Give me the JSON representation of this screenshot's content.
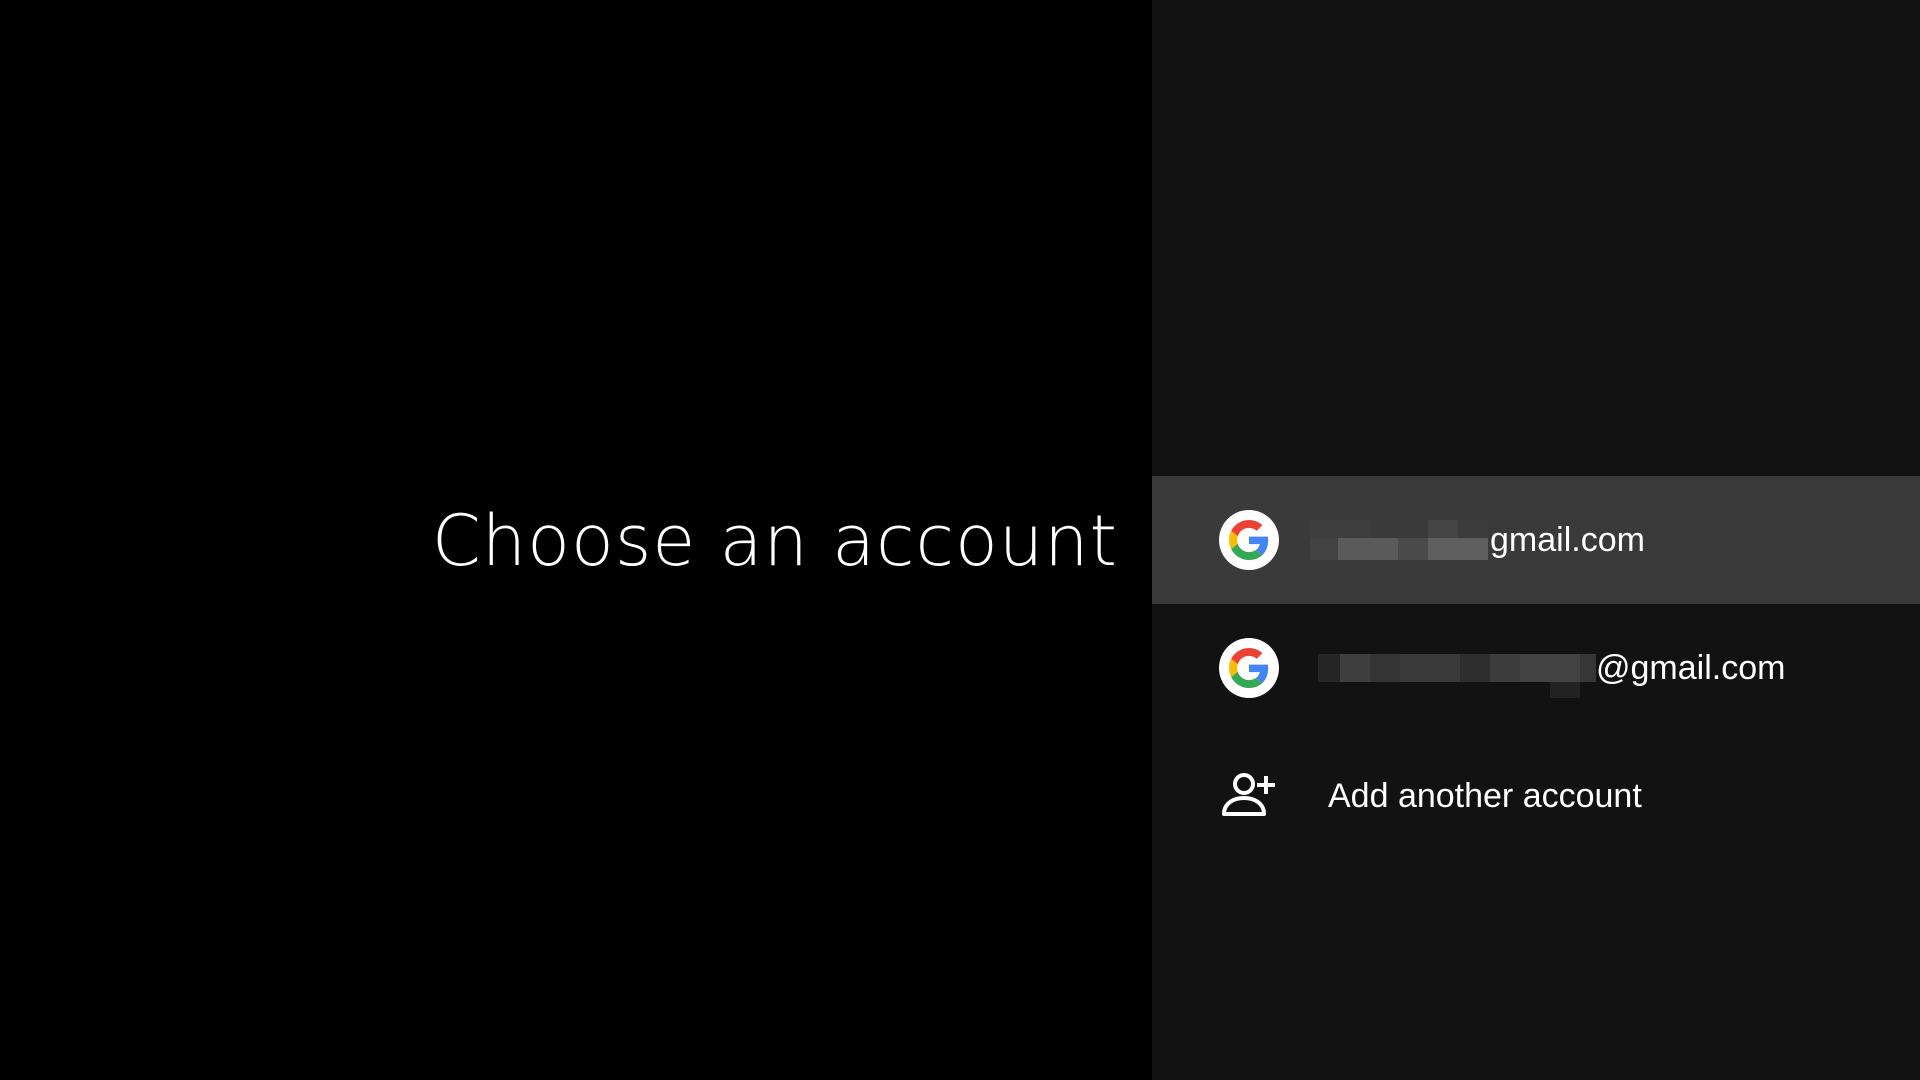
{
  "title": "Choose an account",
  "accounts": [
    {
      "email_visible": "gmail.com",
      "focused": true
    },
    {
      "email_visible": "@gmail.com",
      "focused": false
    }
  ],
  "add_account": {
    "label": "Add another account"
  },
  "colors": {
    "left_background": "#000000",
    "right_background": "#121212",
    "focused_row": "#3a3a3a",
    "text": "#ffffff"
  },
  "icons": {
    "account": "google-g-icon",
    "add": "person-add-icon"
  }
}
